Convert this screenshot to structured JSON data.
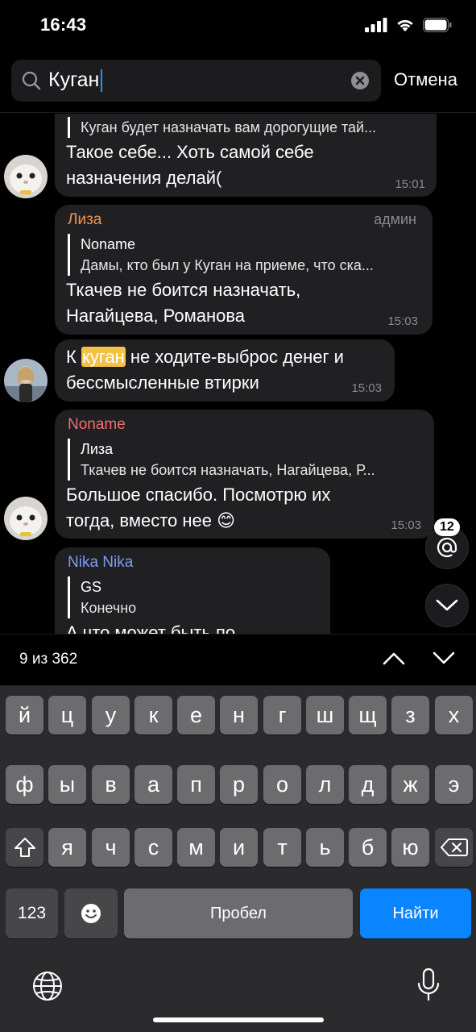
{
  "status_bar": {
    "time": "16:43"
  },
  "search": {
    "query": "Куган",
    "cancel_label": "Отмена"
  },
  "messages": [
    {
      "quote_text": "Куган будет назначать вам дорогущие тай...",
      "text_line1": "Такое себе... Хоть самой себе",
      "text_line2": "назначения делай(",
      "time": "15:01"
    },
    {
      "sender": "Лиза",
      "badge": "админ",
      "quote_author": "Noname",
      "quote_text": "Дамы, кто был у Куган на приеме, что ска...",
      "text_line1": "Ткачев не боится назначать,",
      "text_line2": "Нагайцева, Романова",
      "time": "15:03"
    },
    {
      "text_prefix": "К ",
      "text_highlight": "куган",
      "text_suffix": " не ходите-выброс денег и",
      "text_line2": "бессмысленные втирки",
      "time": "15:03"
    },
    {
      "sender": "Noname",
      "quote_author": "Лиза",
      "quote_text": "Ткачев не боится назначать, Нагайцева, Р...",
      "text_line1": "Большое спасибо. Посмотрю их",
      "text_line2": "тогда, вместо нее 😊",
      "time": "15:03"
    },
    {
      "sender": "Nika Nika",
      "quote_author": "GS",
      "quote_text": "Конечно",
      "text_line1": "А что может быть по"
    }
  ],
  "mention_count": "12",
  "results": {
    "count_label": "9 из 362"
  },
  "keyboard": {
    "row1": [
      "й",
      "ц",
      "у",
      "к",
      "е",
      "н",
      "г",
      "ш",
      "щ",
      "з",
      "х"
    ],
    "row2": [
      "ф",
      "ы",
      "в",
      "а",
      "п",
      "р",
      "о",
      "л",
      "д",
      "ж",
      "э"
    ],
    "row3": [
      "я",
      "ч",
      "с",
      "м",
      "и",
      "т",
      "ь",
      "б",
      "ю"
    ],
    "numbers_label": "123",
    "space_label": "Пробел",
    "go_label": "Найти"
  },
  "colors": {
    "sender_liza": "#f0934f",
    "sender_noname": "#f36d6d",
    "sender_nika": "#7d9cf5",
    "highlight": "#f4c243",
    "accent": "#0a84ff"
  }
}
